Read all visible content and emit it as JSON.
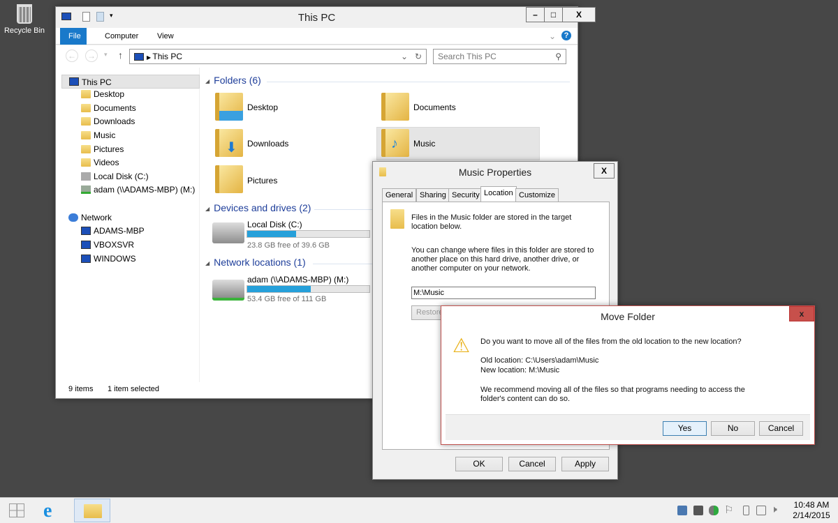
{
  "desktop": {
    "recycle_bin": "Recycle Bin"
  },
  "explorer": {
    "title": "This PC",
    "ribbon_tabs": [
      "File",
      "Computer",
      "View"
    ],
    "address": "This PC",
    "search_placeholder": "Search This PC",
    "nav": [
      {
        "label": "This PC",
        "selected": true
      },
      {
        "label": "Desktop"
      },
      {
        "label": "Documents"
      },
      {
        "label": "Downloads"
      },
      {
        "label": "Music"
      },
      {
        "label": "Pictures"
      },
      {
        "label": "Videos"
      },
      {
        "label": "Local Disk (C:)"
      },
      {
        "label": "adam (\\\\ADAMS-MBP) (M:)"
      },
      {
        "label": "Network"
      },
      {
        "label": "ADAMS-MBP"
      },
      {
        "label": "VBOXSVR"
      },
      {
        "label": "WINDOWS"
      }
    ],
    "groups": {
      "folders": "Folders (6)",
      "devices": "Devices and drives (2)",
      "network": "Network locations (1)"
    },
    "folders": [
      "Desktop",
      "Documents",
      "Downloads",
      "Music",
      "Pictures"
    ],
    "drives": [
      {
        "name": "Local Disk (C:)",
        "free": "23.8 GB free of 39.6 GB",
        "used_fraction": 0.4
      },
      {
        "name": "adam (\\\\ADAMS-MBP) (M:)",
        "free": "53.4 GB free of 111 GB",
        "used_fraction": 0.52
      }
    ],
    "status": {
      "items": "9 items",
      "selected": "1 item selected"
    },
    "accent": "#1979ca"
  },
  "properties": {
    "title": "Music Properties",
    "tabs": [
      "General",
      "Sharing",
      "Security",
      "Location",
      "Customize"
    ],
    "active_tab": "Location",
    "text1": "Files in the Music folder are stored in the target location below.",
    "text2": "You can change where files in this folder are stored to another place on this hard drive, another drive, or another computer on your network.",
    "path": "M:\\Music",
    "restore": "Restore",
    "ok": "OK",
    "cancel": "Cancel",
    "apply": "Apply"
  },
  "move": {
    "title": "Move Folder",
    "question": "Do you want to move all of the files from the old location to the new location?",
    "old": "Old location: C:\\Users\\adam\\Music",
    "new": "New location: M:\\Music",
    "recommend": "We recommend moving all of the files so that programs needing to access the folder's content can do so.",
    "yes": "Yes",
    "no": "No",
    "cancel": "Cancel"
  },
  "taskbar": {
    "time": "10:48 AM",
    "date": "2/14/2015"
  }
}
